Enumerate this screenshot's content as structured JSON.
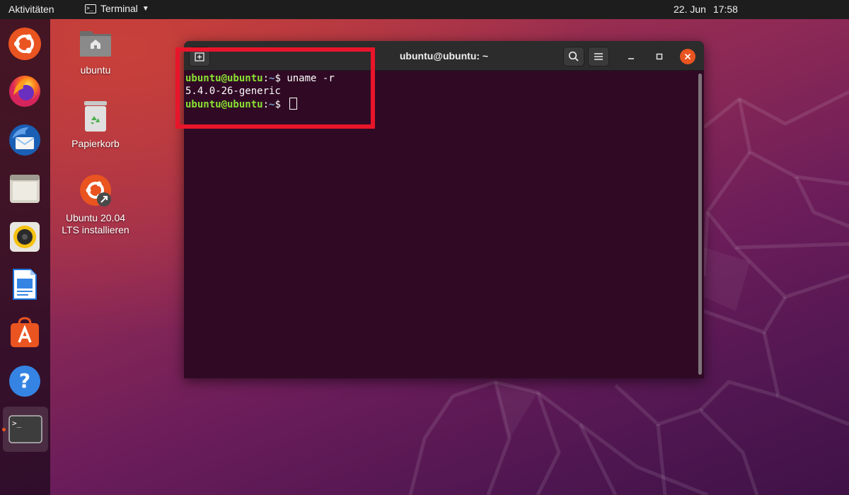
{
  "topbar": {
    "activities": "Aktivitäten",
    "app_menu_label": "Terminal",
    "app_menu_icon": "terminal-icon",
    "date": "22. Jun",
    "time": "17:58"
  },
  "dock": {
    "items": [
      {
        "name": "ubuntu-installer",
        "icon": "ubuntu-logo-icon"
      },
      {
        "name": "firefox",
        "icon": "firefox-icon"
      },
      {
        "name": "thunderbird",
        "icon": "thunderbird-icon"
      },
      {
        "name": "files",
        "icon": "folder-icon"
      },
      {
        "name": "rhythmbox",
        "icon": "speaker-icon"
      },
      {
        "name": "libreoffice-writer",
        "icon": "document-icon"
      },
      {
        "name": "ubuntu-software",
        "icon": "shopping-bag-icon"
      },
      {
        "name": "help",
        "icon": "question-icon"
      },
      {
        "name": "terminal",
        "icon": "terminal-icon",
        "running": true
      }
    ]
  },
  "desktop": {
    "icons": [
      {
        "label": "ubuntu",
        "icon": "home-folder-icon"
      },
      {
        "label": "Papierkorb",
        "icon": "trash-icon"
      },
      {
        "label": "Ubuntu 20.04 LTS installieren",
        "icon": "ubuntu-installer-icon"
      }
    ]
  },
  "terminal": {
    "title": "ubuntu@ubuntu: ~",
    "lines": [
      {
        "user": "ubuntu@ubuntu",
        "sep": ":",
        "path": "~",
        "prompt": "$ ",
        "command": "uname -r"
      },
      {
        "output": "5.4.0-26-generic"
      },
      {
        "user": "ubuntu@ubuntu",
        "sep": ":",
        "path": "~",
        "prompt": "$ ",
        "command": ""
      }
    ]
  },
  "colors": {
    "accent": "#e95420",
    "terminal_bg": "#300a24",
    "prompt_user": "#8ae234",
    "prompt_path": "#729fcf",
    "highlight": "#e8152a"
  }
}
